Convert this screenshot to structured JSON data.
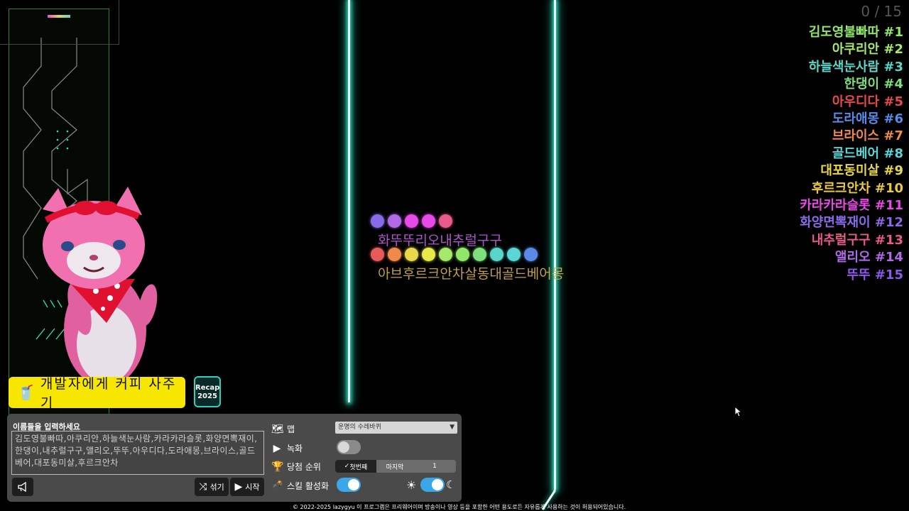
{
  "counter": "0 / 15",
  "ranking": [
    {
      "name": "김도영불빠따 #1",
      "color": "#8fe86a"
    },
    {
      "name": "아쿠리안 #2",
      "color": "#a5e86a"
    },
    {
      "name": "하늘색눈사람 #3",
      "color": "#5ad6c8"
    },
    {
      "name": "한댕이 #4",
      "color": "#7ee07a"
    },
    {
      "name": "아우디다 #5",
      "color": "#e84a4a"
    },
    {
      "name": "도라애몽 #6",
      "color": "#5a8ae8"
    },
    {
      "name": "브라이스 #7",
      "color": "#f08a4a"
    },
    {
      "name": "골드베어 #8",
      "color": "#5ad6d8"
    },
    {
      "name": "대포동미살 #9",
      "color": "#e8d84a"
    },
    {
      "name": "후르크안차 #10",
      "color": "#e8c84a"
    },
    {
      "name": "카라카라슬롯 #11",
      "color": "#e84ae8"
    },
    {
      "name": "화양면뽁재이 #12",
      "color": "#8a6ae8"
    },
    {
      "name": "내추럴구구 #13",
      "color": "#e85a8a"
    },
    {
      "name": "앨리오 #14",
      "color": "#b06ae8"
    },
    {
      "name": "뚜뚜 #15",
      "color": "#8a5ae8"
    }
  ],
  "marbles_top": [
    "#8a6ae8",
    "#b06ae8",
    "#e84ae8",
    "#e84ae8",
    "#e85a8a"
  ],
  "marbles_bottom": [
    "#e85a5a",
    "#f08a4a",
    "#e8d84a",
    "#e8e84a",
    "#a5e86a",
    "#8fe86a",
    "#7ee07a",
    "#5ad6c8",
    "#5ad6d8",
    "#5a8ae8"
  ],
  "marble_label_top": "화뚜뚜리오내추럴구구",
  "marble_label_bottom": "아브후르크안차살동대골드베어몽",
  "coffee_button": "개발자에게 커피 사주기",
  "recap_button": {
    "line1": "Recap",
    "line2": "2025"
  },
  "panel": {
    "names_label": "이름들을 입력하세요",
    "names_value": "김도영불빠따,아쿠리안,하늘색눈사람,카라카라슬롯,화양면뽁재이,한댕이,내추럴구구,앨리오,뚜뚜,아우디다,도라애몽,브라이스,골드베어,대포동미살,후르크안차",
    "shuffle": "섞기",
    "start": "시작",
    "map_label": "맵",
    "map_value": "운명의 수레바퀴",
    "record_label": "녹화",
    "rank_label": "당첨 순위",
    "rank_first": "첫번째",
    "rank_last": "마지막",
    "rank_number": "1",
    "skill_label": "스킬 활성화"
  },
  "copyright": "© 2022-2025 lazygyu 이 프로그램은 프리웨어이며 방송이나 영상 등을 포함한 어떤 용도로든 자유롭게 사용하는 것이 허용되어있습니다.",
  "colors": {
    "wall": "#2fe0c0",
    "toggle_on": "#3aa8e8",
    "coffee": "#f6e600"
  }
}
